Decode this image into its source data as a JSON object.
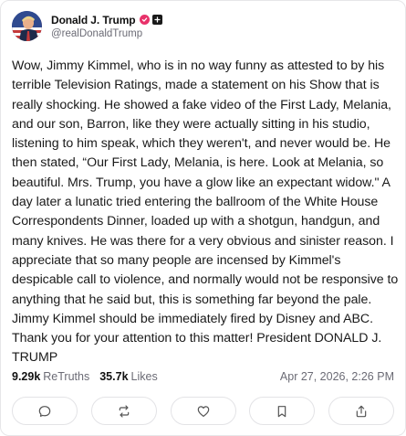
{
  "author": {
    "display_name": "Donald J. Trump",
    "handle": "@realDonaldTrump",
    "avatar_icon": "profile-photo",
    "verified_color": "#e8326a"
  },
  "post": {
    "text": "Wow, Jimmy Kimmel, who is in no way funny as attested to by his terrible Television Ratings, made a statement on his Show that is really shocking. He showed a fake video of the First Lady, Melania, and our son, Barron, like they were actually sitting in his studio, listening to him speak, which they weren't, and never would be. He then stated, “Our First Lady, Melania, is here. Look at Melania, so beautiful. Mrs. Trump, you have a glow like an expectant widow.\" A day later a lunatic tried entering the ballroom of the White House Correspondents Dinner, loaded up with a shotgun, handgun, and many knives. He was there for a very obvious and sinister reason. I appreciate that so many people are incensed by Kimmel's despicable call to violence, and normally would not be responsive to anything that he said but, this is something far beyond the pale. Jimmy Kimmel should be immediately fired by Disney and ABC. Thank you for your attention to this matter! President DONALD J. TRUMP"
  },
  "stats": {
    "retruths_count": "9.29k",
    "retruths_label": "ReTruths",
    "likes_count": "35.7k",
    "likes_label": "Likes",
    "timestamp": "Apr 27, 2026, 2:26 PM"
  },
  "actions": [
    {
      "name": "reply",
      "icon": "comment-icon"
    },
    {
      "name": "retruth",
      "icon": "repost-icon"
    },
    {
      "name": "like",
      "icon": "heart-icon"
    },
    {
      "name": "bookmark",
      "icon": "bookmark-icon"
    },
    {
      "name": "share",
      "icon": "share-icon"
    }
  ]
}
